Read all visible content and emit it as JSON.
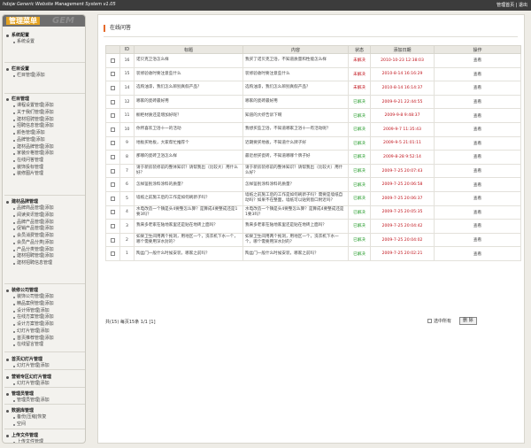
{
  "topbar": {
    "title": "hdsjw Generic Website Management System v1.05",
    "links": "管理首页 | 退出"
  },
  "logo": {
    "title": "管理菜单",
    "badge": "GEM"
  },
  "menu": [
    {
      "header": "系统配置",
      "items": [
        "系统设置"
      ]
    },
    {
      "header": "栏目设置",
      "items": [
        "栏目管理|添加"
      ]
    },
    {
      "header": "栏目管理",
      "items": [
        "课程设置管理|添加",
        "关于我们管理|添加",
        "建材招骋管理|添加",
        "招聘信息管理|添加",
        "颜色管理|添加",
        "品牌管理|添加",
        "建材品牌管理|添加",
        "家装价格管理|添加",
        "在线问答管理",
        "装饰投标管理",
        "装修图片管理"
      ]
    },
    {
      "header": "建材品牌管理",
      "items": [
        "品牌商品管理|添加",
        "阅读资讯管理|添加",
        "品牌产品管理|添加",
        "促销产品管理|添加",
        "会员消费管理|添加",
        "会员产品分类|添加",
        "产品分类管理|添加",
        "建材招聘管理|添加",
        "建材招聘信息管理"
      ]
    },
    {
      "header": "装修公司管理",
      "items": [
        "装饰公司管理|添加",
        "精品案例管理|添加",
        "设计师管理|添加",
        "在线方案管理|添加",
        "设计方案管理|添加",
        "幻灯片管理|添加",
        "首页推荐管理|添加",
        "在线留言管理"
      ]
    },
    {
      "header": "首页幻灯片管理",
      "items": [
        "幻灯片管理|添加"
      ]
    },
    {
      "header": "营销专区幻灯片管理",
      "items": [
        "幻灯片管理|添加"
      ]
    },
    {
      "header": "管理员管理",
      "items": [
        "管理员管理|添加"
      ]
    },
    {
      "header": "数据库管理",
      "items": [
        "备份|压缩|恢复",
        "空间"
      ]
    },
    {
      "header": "上传文件管理",
      "items": [
        "上传文件管理"
      ]
    }
  ],
  "main": {
    "title": "在线问答"
  },
  "table": {
    "headers": [
      "",
      "ID",
      "标题",
      "内容",
      "状态",
      "添加日期",
      "操作"
    ],
    "rows": [
      {
        "id": "16",
        "title": "诺贝克卫浴怎么样",
        "content": "我买了诺贝克卫浴，不知道质量和性能怎么样",
        "status": "未解决",
        "date": "2010-10-23 12:38:03",
        "op": "查看"
      },
      {
        "id": "15",
        "title": "装修验收时要注意些什么",
        "content": "装修验收时要注意些什么",
        "status": "未解决",
        "date": "2010-8-14 16:16:29",
        "op": "查看"
      },
      {
        "id": "14",
        "title": "选购油漆，我们怎么辨别真假产品？",
        "content": "选购油漆，我们怎么辨别真假产品？",
        "status": "未解决",
        "date": "2010-8-14 16:14:37",
        "op": "查看"
      },
      {
        "id": "12",
        "title": "哪家的瓷砖最好用",
        "content": "哪家的瓷砖最好用",
        "status": "已解决",
        "date": "2009-9-21 22:44:55",
        "op": "查看"
      },
      {
        "id": "11",
        "title": "橱柜材质还是增加好呢？",
        "content": "知道的大虾告诉下啊",
        "status": "已解决",
        "date": "2009-9-8 9:48:37",
        "op": "查看"
      },
      {
        "id": "10",
        "title": "你所喜欢卫浴十一的活动",
        "content": "我想买些卫浴，不知道哪家卫浴十一有活动呢？",
        "status": "已解决",
        "date": "2009-9-7 11:35:43",
        "op": "查看"
      },
      {
        "id": "9",
        "title": "地板买地板，大家帮忙推荐个",
        "content": "近期要买地板，不知道什么牌子好",
        "status": "已解决",
        "date": "2009-9-5 21:01:11",
        "op": "查看"
      },
      {
        "id": "8",
        "title": "那哪的瓷砖卫浴怎么样",
        "content": "最近想买瓷砖，不知道哪哪个牌子好",
        "status": "已解决",
        "date": "2009-8-28 9:52:14",
        "op": "查看"
      },
      {
        "id": "7",
        "title": "请于新房装修前的整体知识？请帮我出（比较大）用什么好？",
        "content": "请于新房装修前的整体知识？请帮我出（比较大）用什么好？",
        "status": "已解决",
        "date": "2009-7-25 20:07:43",
        "op": "查看"
      },
      {
        "id": "6",
        "title": "怎样鉴别涂料涂料的质量？",
        "content": "怎样鉴别涂料涂料的质量？",
        "status": "已解决",
        "date": "2009-7-25 20:06:58",
        "op": "查看"
      },
      {
        "id": "5",
        "title": "墙纸之前施工后的工作是如何刷新子吗？",
        "content": "墙纸之前施工后的工作是如何刷新子吗？需要是墙纸自动吗？如果不在整面，墙纸可以贴到窗口附近吗？",
        "status": "已解决",
        "date": "2009-7-25 20:06:37",
        "op": "查看"
      },
      {
        "id": "4",
        "title": "水电改造一个镇是头4要整怎么算？是算成4要整成还是1要3吗？",
        "content": "水电改造一个镇是头4要整怎么算？是算成4要整成还是1要3吗？",
        "status": "已解决",
        "date": "2009-7-25 20:05:35",
        "op": "查看"
      },
      {
        "id": "3",
        "title": "我来多老家在陆地家里还是贴在地砖上面吗？",
        "content": "我来多老家在陆地家里还是贴在地砖上面吗？",
        "status": "已解决",
        "date": "2009-7-25 20:04:42",
        "op": "查看"
      },
      {
        "id": "2",
        "title": "如果卫生间用两个拖洞，用地区一个，洗衣机下水一个，哪个需要用深水封的？",
        "content": "如果卫生间用两个拖洞，用地区一个，洗衣机下水一个，哪个需要用深水封的？",
        "status": "已解决",
        "date": "2009-7-25 20:04:02",
        "op": "查看"
      },
      {
        "id": "1",
        "title": "陶盆门一般什么时候安装，哪家之前吗？",
        "content": "陶盆门一般什么时候安装，哪家之前吗？",
        "status": "已解决",
        "date": "2009-7-25 20:02:21",
        "op": "查看"
      }
    ]
  },
  "footer": {
    "pagination": "共(15) 每页15条 1/1 [1]",
    "select_all": "选中所有",
    "delete_button": "删 除"
  }
}
